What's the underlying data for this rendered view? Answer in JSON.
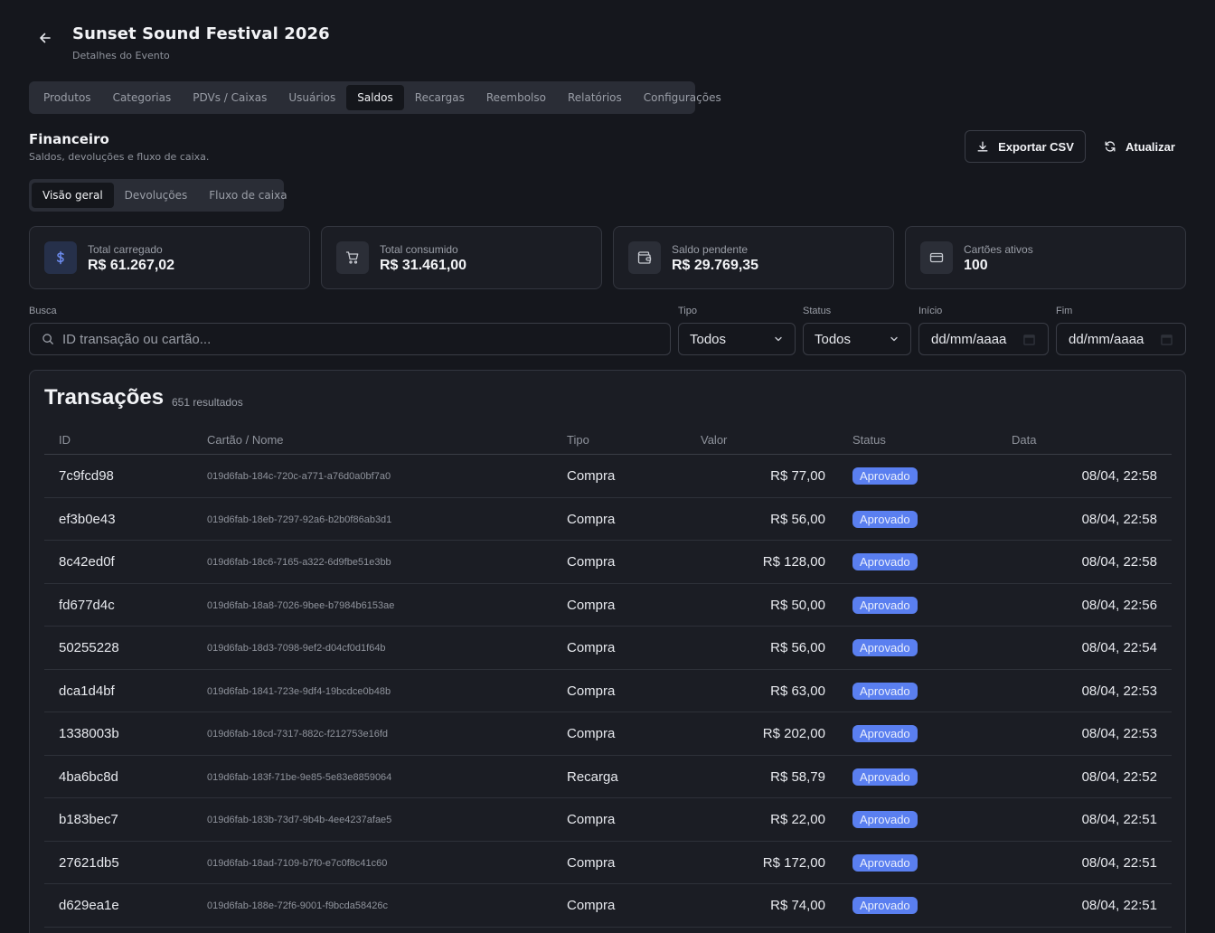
{
  "header": {
    "title": "Sunset Sound Festival 2026",
    "subtitle": "Detalhes do Evento"
  },
  "main_tabs": [
    {
      "label": "Produtos",
      "active": false
    },
    {
      "label": "Categorias",
      "active": false
    },
    {
      "label": "PDVs / Caixas",
      "active": false
    },
    {
      "label": "Usuários",
      "active": false
    },
    {
      "label": "Saldos",
      "active": true
    },
    {
      "label": "Recargas",
      "active": false
    },
    {
      "label": "Reembolso",
      "active": false
    },
    {
      "label": "Relatórios",
      "active": false
    },
    {
      "label": "Configurações",
      "active": false
    }
  ],
  "section": {
    "title": "Financeiro",
    "subtitle": "Saldos, devoluções e fluxo de caixa."
  },
  "actions": {
    "export_label": "Exportar CSV",
    "refresh_label": "Atualizar"
  },
  "sub_tabs": [
    {
      "label": "Visão geral",
      "active": true
    },
    {
      "label": "Devoluções",
      "active": false
    },
    {
      "label": "Fluxo de caixa",
      "active": false
    }
  ],
  "stats": [
    {
      "icon": "dollar-icon",
      "label": "Total carregado",
      "value": "R$ 61.267,02"
    },
    {
      "icon": "cart-icon",
      "label": "Total consumido",
      "value": "R$ 31.461,00"
    },
    {
      "icon": "wallet-icon",
      "label": "Saldo pendente",
      "value": "R$ 29.769,35"
    },
    {
      "icon": "credit-card-icon",
      "label": "Cartões ativos",
      "value": "100"
    }
  ],
  "filters": {
    "search_label": "Busca",
    "search_placeholder": "ID transação ou cartão...",
    "tipo_label": "Tipo",
    "tipo_value": "Todos",
    "status_label": "Status",
    "status_value": "Todos",
    "inicio_label": "Início",
    "inicio_value": "dd/mm/aaaa",
    "fim_label": "Fim",
    "fim_value": "dd/mm/aaaa"
  },
  "table": {
    "title": "Transações",
    "count": "651 resultados",
    "columns": [
      "ID",
      "Cartão / Nome",
      "Tipo",
      "Valor",
      "Status",
      "Data"
    ],
    "rows": [
      [
        "7c9fcd98",
        "019d6fab-184c-720c-a771-a76d0a0bf7a0",
        "Compra",
        "R$ 77,00",
        "Aprovado",
        "08/04, 22:58"
      ],
      [
        "ef3b0e43",
        "019d6fab-18eb-7297-92a6-b2b0f86ab3d1",
        "Compra",
        "R$ 56,00",
        "Aprovado",
        "08/04, 22:58"
      ],
      [
        "8c42ed0f",
        "019d6fab-18c6-7165-a322-6d9fbe51e3bb",
        "Compra",
        "R$ 128,00",
        "Aprovado",
        "08/04, 22:58"
      ],
      [
        "fd677d4c",
        "019d6fab-18a8-7026-9bee-b7984b6153ae",
        "Compra",
        "R$ 50,00",
        "Aprovado",
        "08/04, 22:56"
      ],
      [
        "50255228",
        "019d6fab-18d3-7098-9ef2-d04cf0d1f64b",
        "Compra",
        "R$ 56,00",
        "Aprovado",
        "08/04, 22:54"
      ],
      [
        "dca1d4bf",
        "019d6fab-1841-723e-9df4-19bcdce0b48b",
        "Compra",
        "R$ 63,00",
        "Aprovado",
        "08/04, 22:53"
      ],
      [
        "1338003b",
        "019d6fab-18cd-7317-882c-f212753e16fd",
        "Compra",
        "R$ 202,00",
        "Aprovado",
        "08/04, 22:53"
      ],
      [
        "4ba6bc8d",
        "019d6fab-183f-71be-9e85-5e83e8859064",
        "Recarga",
        "R$ 58,79",
        "Aprovado",
        "08/04, 22:52"
      ],
      [
        "b183bec7",
        "019d6fab-183b-73d7-9b4b-4ee4237afae5",
        "Compra",
        "R$ 22,00",
        "Aprovado",
        "08/04, 22:51"
      ],
      [
        "27621db5",
        "019d6fab-18ad-7109-b7f0-e7c0f8c41c60",
        "Compra",
        "R$ 172,00",
        "Aprovado",
        "08/04, 22:51"
      ],
      [
        "d629ea1e",
        "019d6fab-188e-72f6-9001-f9bcda58426c",
        "Compra",
        "R$ 74,00",
        "Aprovado",
        "08/04, 22:51"
      ]
    ]
  },
  "colors": {
    "background": "#15171d",
    "card": "#1b1d24",
    "accent": "#5a7ff0",
    "status_approved": "#5a7ff0"
  }
}
